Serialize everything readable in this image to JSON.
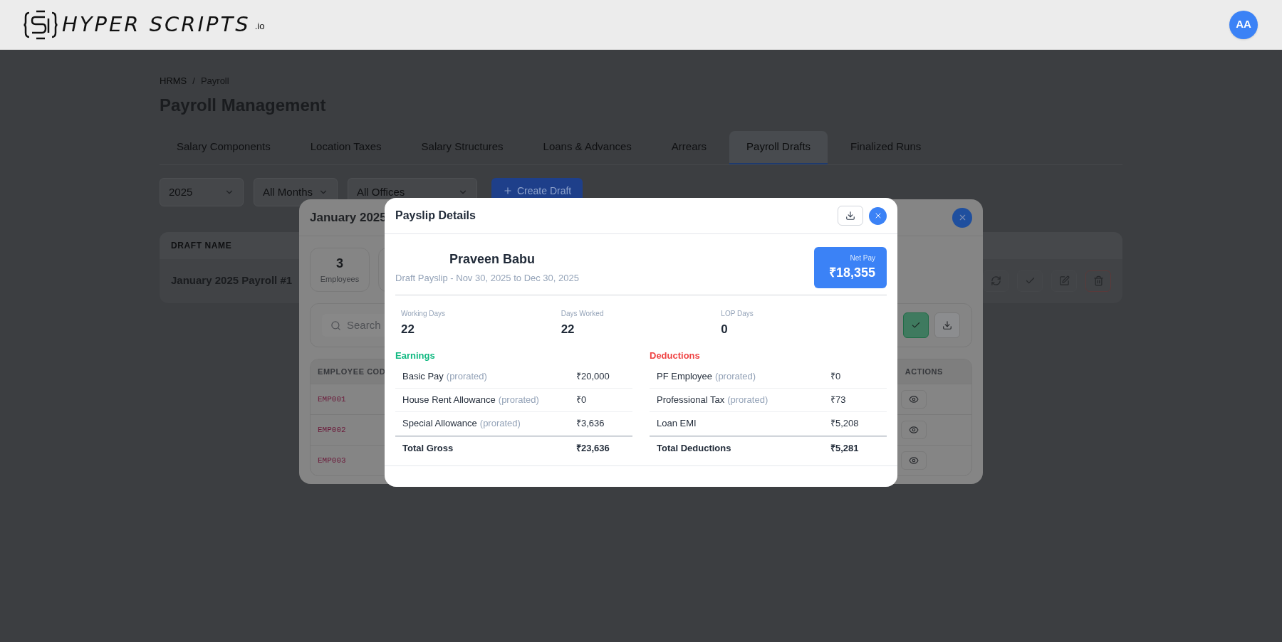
{
  "header": {
    "logo": {
      "name": "HYPER SCRIPTS",
      "suffix": ".io"
    },
    "avatar": "AA"
  },
  "page": {
    "breadcrumb": [
      "HRMS",
      "Payroll"
    ],
    "breadcrumb_separator": "/",
    "title": "Payroll Management",
    "tabs": [
      {
        "label": "Salary Components",
        "selected": false
      },
      {
        "label": "Location Taxes",
        "selected": false
      },
      {
        "label": "Salary Structures",
        "selected": false
      },
      {
        "label": "Loans & Advances",
        "selected": false
      },
      {
        "label": "Arrears",
        "selected": false
      },
      {
        "label": "Payroll Drafts",
        "selected": true
      },
      {
        "label": "Finalized Runs",
        "selected": false
      }
    ],
    "filters": [
      {
        "value": "2025"
      },
      {
        "value": "All Months"
      },
      {
        "value": "All Offices"
      }
    ],
    "create_button": "Create Draft",
    "drafts_table": {
      "columns": [
        "DRAFT NAME"
      ],
      "rows": [
        {
          "draft_name": "January 2025 Payroll #1"
        }
      ]
    }
  },
  "draft_modal": {
    "title": "January 2025",
    "stats": [
      {
        "value": "3",
        "label": "Employees"
      }
    ],
    "search": {
      "placeholder": "Search"
    },
    "table": {
      "columns": [
        "EMPLOYEE COD",
        "ACTIONS"
      ],
      "rows": [
        {
          "code": "EMP001"
        },
        {
          "code": "EMP002"
        },
        {
          "code": "EMP003"
        }
      ]
    }
  },
  "payslip": {
    "title": "Payslip Details",
    "employee": "Praveen Babu",
    "subtitle": "Draft Payslip - Nov 30, 2025 to Dec 30, 2025",
    "net_pay": {
      "label": "Net Pay",
      "amount": "₹18,355"
    },
    "stats": [
      {
        "label": "Working Days",
        "value": "22"
      },
      {
        "label": "Days Worked",
        "value": "22"
      },
      {
        "label": "LOP Days",
        "value": "0"
      }
    ],
    "sections": [
      {
        "kind": "earnings",
        "title": "Earnings",
        "rows": [
          {
            "label": "Basic Pay",
            "note": "(prorated)",
            "amount": "₹20,000"
          },
          {
            "label": "House Rent Allowance",
            "note": "(prorated)",
            "amount": "₹0"
          },
          {
            "label": "Special Allowance",
            "note": "(prorated)",
            "amount": "₹3,636"
          }
        ],
        "total": {
          "label": "Total Gross",
          "amount": "₹23,636"
        }
      },
      {
        "kind": "deductions",
        "title": "Deductions",
        "rows": [
          {
            "label": "PF Employee",
            "note": "(prorated)",
            "amount": "₹0"
          },
          {
            "label": "Professional Tax",
            "note": "(prorated)",
            "amount": "₹73"
          },
          {
            "label": "Loan EMI",
            "amount": "₹5,208"
          }
        ],
        "total": {
          "label": "Total Deductions",
          "amount": "₹5,281"
        }
      }
    ]
  }
}
